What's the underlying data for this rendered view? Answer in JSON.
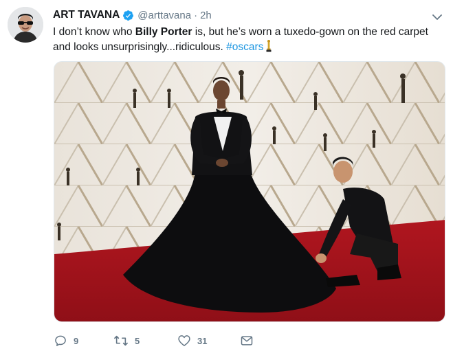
{
  "tweet": {
    "display_name": "ART TAVANA",
    "handle": "@arttavana",
    "separator": "·",
    "time": "2h",
    "text_part1": "I don’t know who ",
    "text_bold": "Billy Porter",
    "text_part2": " is, but he’s worn a tuxedo-gown on the red carpet and looks unsurprisingly...ridiculous. ",
    "hashtag": "#oscars"
  },
  "actions": {
    "reply_count": "9",
    "retweet_count": "5",
    "like_count": "31"
  },
  "icons": {
    "verified": "verified-badge-icon",
    "caret": "chevron-down-icon",
    "reply": "reply-icon",
    "retweet": "retweet-icon",
    "like": "heart-icon",
    "dm": "envelope-icon"
  },
  "colors": {
    "accent": "#1da1f2",
    "hashtag": "#1b95e0",
    "secondary_text": "#657786",
    "carpet": "#a3141c"
  }
}
